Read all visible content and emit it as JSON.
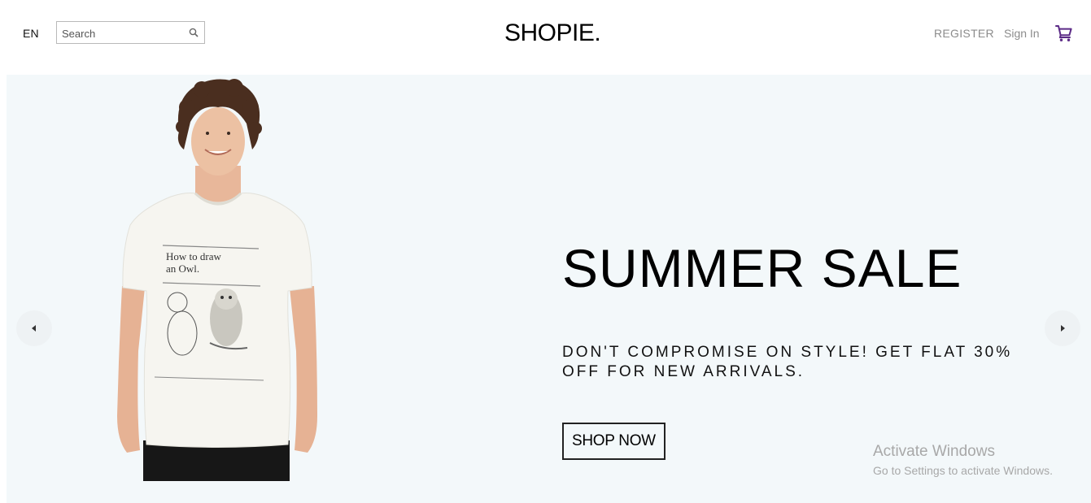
{
  "header": {
    "language": "EN",
    "search_placeholder": "Search",
    "logo": "SHOPIE.",
    "register_label": "REGISTER",
    "signin_label": "Sign In",
    "cart_icon": "shopping-cart-icon",
    "cart_color": "#5b2a86"
  },
  "slide": {
    "title": "SUMMER SALE",
    "description": "DON'T COMPROMISE ON STYLE! GET FLAT 30% OFF FOR NEW ARRIVALS.",
    "button_label": "SHOP NOW",
    "background": "#f3f8fa"
  },
  "watermark": {
    "title": "Activate Windows",
    "subtitle": "Go to Settings to activate Windows."
  }
}
